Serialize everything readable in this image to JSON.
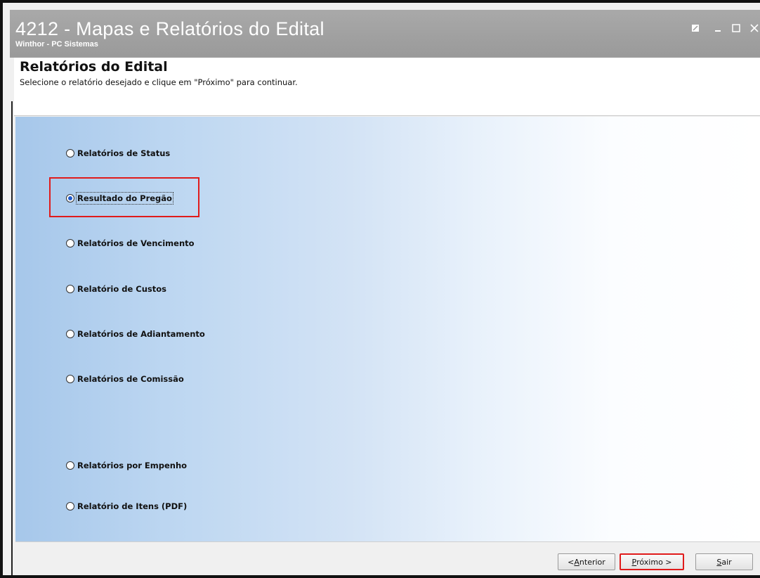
{
  "window": {
    "title": "4212 - Mapas e Relatórios do Edital",
    "subtitle": "Winthor - PC Sistemas"
  },
  "header": {
    "title": "Relatórios do Edital",
    "description": "Selecione o relatório desejado e clique em \"Próximo\" para continuar."
  },
  "options": [
    {
      "label": "Relatórios de Status",
      "checked": false
    },
    {
      "label": "Resultado do Pregão",
      "checked": true
    },
    {
      "label": "Relatórios de Vencimento",
      "checked": false
    },
    {
      "label": "Relatório de Custos",
      "checked": false
    },
    {
      "label": "Relatórios de Adiantamento",
      "checked": false
    },
    {
      "label": "Relatórios de Comissão",
      "checked": false
    },
    {
      "label": "Relatórios por Empenho",
      "checked": false
    },
    {
      "label": "Relatório de Itens (PDF)",
      "checked": false
    }
  ],
  "buttons": {
    "previous_prefix": "< ",
    "previous_key": "A",
    "previous_rest": "nterior",
    "next_key": "P",
    "next_rest": "róximo >",
    "exit_key": "S",
    "exit_rest": "air"
  },
  "colors": {
    "highlight": "#e01b1b",
    "radio_selected": "#1e5bcf",
    "titlebar": "#a0a0a0"
  }
}
